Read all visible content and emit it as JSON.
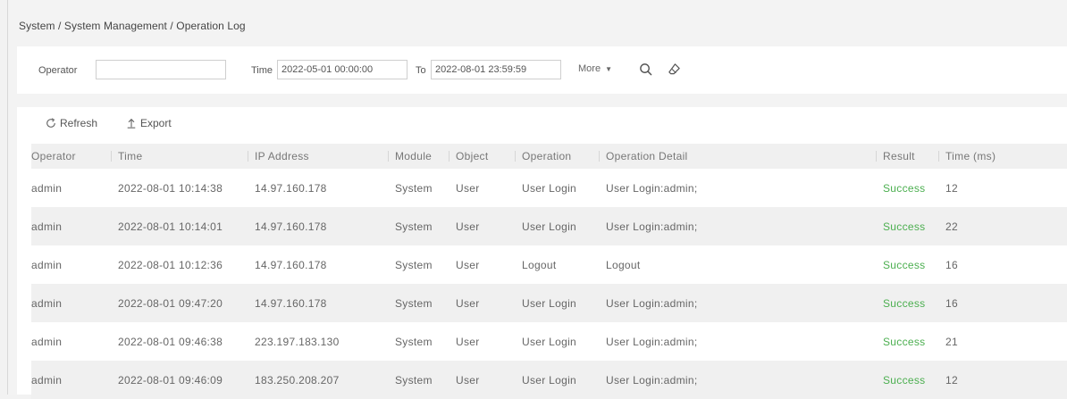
{
  "breadcrumb": "System / System Management / Operation Log",
  "search": {
    "operator_label": "Operator",
    "operator_value": "",
    "time_label": "Time",
    "time_from": "2022-05-01 00:00:00",
    "to_label": "To",
    "time_to": "2022-08-01 23:59:59",
    "more_label": "More",
    "search_icon": "search-icon",
    "clear_icon": "eraser-icon"
  },
  "toolbar": {
    "refresh_label": "Refresh",
    "export_label": "Export"
  },
  "table": {
    "headers": [
      "Operator",
      "Time",
      "IP Address",
      "Module",
      "Object",
      "Operation",
      "Operation Detail",
      "Result",
      "Time (ms)"
    ],
    "rows": [
      [
        "admin",
        "2022-08-01 10:14:38",
        "14.97.160.178",
        "System",
        "User",
        "User Login",
        "User Login:admin;",
        "Success",
        "12"
      ],
      [
        "admin",
        "2022-08-01 10:14:01",
        "14.97.160.178",
        "System",
        "User",
        "User Login",
        "User Login:admin;",
        "Success",
        "22"
      ],
      [
        "admin",
        "2022-08-01 10:12:36",
        "14.97.160.178",
        "System",
        "User",
        "Logout",
        "Logout",
        "Success",
        "16"
      ],
      [
        "admin",
        "2022-08-01 09:47:20",
        "14.97.160.178",
        "System",
        "User",
        "User Login",
        "User Login:admin;",
        "Success",
        "16"
      ],
      [
        "admin",
        "2022-08-01 09:46:38",
        "223.197.183.130",
        "System",
        "User",
        "User Login",
        "User Login:admin;",
        "Success",
        "21"
      ],
      [
        "admin",
        "2022-08-01 09:46:09",
        "183.250.208.207",
        "System",
        "User",
        "User Login",
        "User Login:admin;",
        "Success",
        "12"
      ]
    ]
  },
  "colors": {
    "success": "#4caf50",
    "row_alt": "#f0f0f0",
    "background": "#f3f3f3"
  }
}
